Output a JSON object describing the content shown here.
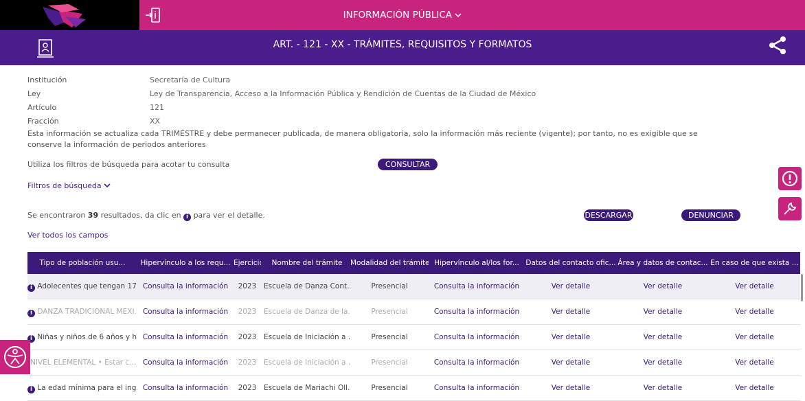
{
  "header": {
    "title": "INFORMACIÓN PÚBLICA",
    "chevron": "chevron-down-icon",
    "enter_icon": "login-icon",
    "colors": {
      "magenta": "#c8247e",
      "purple": "#4a1c8c",
      "dark_purple": "#3b1a7a"
    }
  },
  "subheader": {
    "title": "ART. - 121 - XX - TRÁMITES, REQUISITOS Y FORMATOS",
    "doc_icon": "id-document-icon",
    "share_icon": "share-icon"
  },
  "info": [
    {
      "label": "Institución",
      "value": "Secretaría de Cultura"
    },
    {
      "label": "Ley",
      "value": "Ley de Transparencia, Acceso a la Información Pública y Rendición de Cuentas de la Ciudad de México"
    },
    {
      "label": "Artículo",
      "value": "121"
    },
    {
      "label": "Fracción",
      "value": "XX"
    }
  ],
  "note": "Esta información se actualiza cada TRIMESTRE y debe permanecer publicada, de manera obligatoria, solo la información más reciente (vigente); por tanto, no es exigible que se conserve la información de periodos anteriores",
  "filter_hint": "Utiliza los filtros de búsqueda para acotar tu consulta",
  "consult_button": "CONSULTAR",
  "filters_link": "Filtros de búsqueda",
  "results": {
    "prefix": "Se encontraron",
    "count": "39",
    "middle": "resultados, da clic en",
    "suffix": "para ver el detalle."
  },
  "download_button": "DESCARGAR",
  "report_button": "DENUNCIAR",
  "all_fields_link": "Ver todos los campos",
  "side_buttons": {
    "alert": "alert-icon",
    "tools": "wrench-icon",
    "up": "arrow-up-icon",
    "accessibility": "accessibility-icon"
  },
  "table": {
    "columns": [
      "Tipo de población usu...",
      "Hipervínculo a los requ...",
      "Ejercicio",
      "Nombre del trámite",
      "Modalidad del trámite",
      "Hipervínculo al/los for...",
      "Datos del contacto ofic...",
      "Área y datos de contac...",
      "En caso de que exista ..."
    ],
    "rows": [
      {
        "c0": "Adolecentes que tengan 17...",
        "c1": "Consulta la información",
        "c2": "2023",
        "c3": "Escuela de Danza Cont...",
        "c4": "Presencial",
        "c5": "Consulta la información",
        "c6": "Ver detalle",
        "c7": "Ver detalle",
        "c8": "Ver detalle",
        "icon": true,
        "style": "dark"
      },
      {
        "c0": "DANZA TRADICIONAL MEXI...",
        "c1": "Consulta la información",
        "c2": "2023",
        "c3": "Escuela de Danza de la...",
        "c4": "Presencial",
        "c5": "Consulta la información",
        "c6": "Ver detalle",
        "c7": "Ver detalle",
        "c8": "Ver detalle",
        "icon": true,
        "style": "dim"
      },
      {
        "c0": "Niñas y niños de 6 años y h...",
        "c1": "Consulta la información",
        "c2": "2023",
        "c3": "Escuela de Iniciación a ...",
        "c4": "Presencial",
        "c5": "Consulta la información",
        "c6": "Ver detalle",
        "c7": "Ver detalle",
        "c8": "Ver detalle",
        "icon": true,
        "style": "dark"
      },
      {
        "c0": "NIVEL ELEMENTAL • Estar c...",
        "c1": "Consulta la información",
        "c2": "2023",
        "c3": "Escuela de Iniciación a ...",
        "c4": "Presencial",
        "c5": "Consulta la información",
        "c6": "Ver detalle",
        "c7": "Ver detalle",
        "c8": "Ver detalle",
        "icon": false,
        "style": "dim"
      },
      {
        "c0": "La edad mínima para el ing...",
        "c1": "Consulta la información",
        "c2": "2023",
        "c3": "Escuela de Mariachi Oll...",
        "c4": "Presencial",
        "c5": "Consulta la información",
        "c6": "Ver detalle",
        "c7": "Ver detalle",
        "c8": "Ver detalle",
        "icon": true,
        "style": "dark"
      }
    ]
  }
}
